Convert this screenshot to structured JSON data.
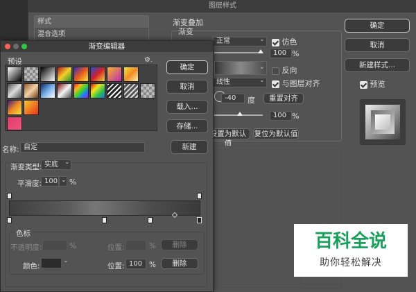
{
  "layer_style": {
    "title": "图层样式",
    "sidebar": [
      "样式",
      "混合选项"
    ],
    "section_title": "渐变叠加",
    "section_sub": "渐变",
    "blend_mode": "正常",
    "dither_label": "仿色",
    "opacity_value": "100",
    "percent": "%",
    "reverse_label": "反向",
    "style_value": "线性",
    "align_label": "与图层对齐",
    "angle_value": "-40",
    "angle_unit": "度",
    "reset_align": "重置对齐",
    "scale_value": "100",
    "set_default": "设置为默认值",
    "reset_default": "复位为默认值",
    "ok": "确定",
    "cancel": "取消",
    "new_style": "新建样式...",
    "preview": "预览"
  },
  "gradient_editor": {
    "title": "渐变编辑器",
    "presets_label": "预设",
    "gear": "⚙.",
    "ok": "确定",
    "cancel": "取消",
    "load": "载入...",
    "save": "存储...",
    "name_label": "名称:",
    "name_value": "自定",
    "new": "新建",
    "type_label": "渐变类型:",
    "type_value": "实底",
    "smooth_label": "平滑度:",
    "smooth_value": "100",
    "smooth_unit": "%",
    "stops_label": "色标",
    "opacity_label": "不透明度:",
    "opacity_unit": "%",
    "position_label": "位置:",
    "position_value": "100",
    "position_unit": "%",
    "delete": "删除",
    "color_label": "颜色:"
  },
  "watermark": {
    "main": "百科全说",
    "sub": "助你轻松解决"
  },
  "colors": {
    "accent_green": "#16a05a",
    "dialog_bg": "#535353"
  }
}
